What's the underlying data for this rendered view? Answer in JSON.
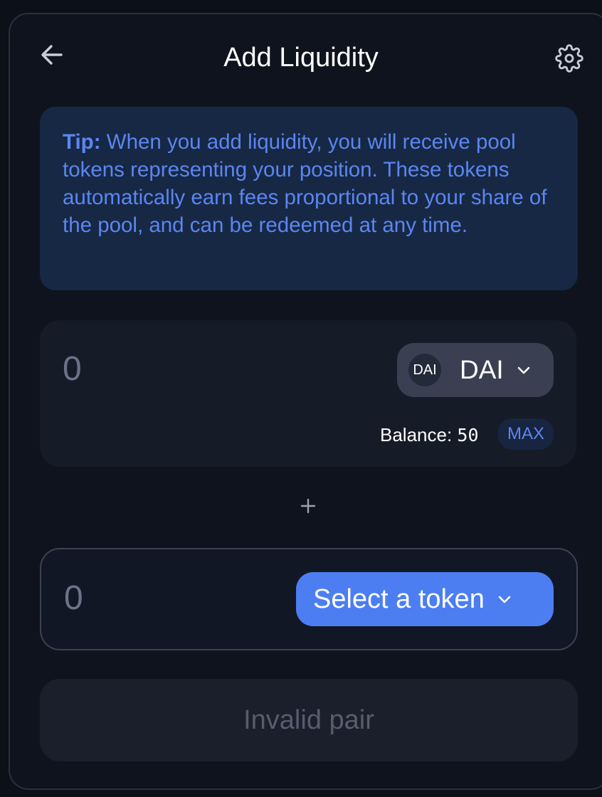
{
  "header": {
    "title": "Add Liquidity",
    "back_icon": "arrow-left-icon",
    "settings_icon": "gear-icon"
  },
  "tip": {
    "label": "Tip:",
    "text": " When you add liquidity, you will receive pool tokens representing your position. These tokens automatically earn fees proportional to your share of the pool, and can be redeemed at any time."
  },
  "input_a": {
    "placeholder": "0",
    "token_logo_text": "DAI",
    "token_symbol": "DAI",
    "balance_label": "Balance: ",
    "balance_value": "50",
    "max_label": "MAX"
  },
  "separator": {
    "icon": "plus-icon"
  },
  "input_b": {
    "placeholder": "0",
    "select_label": "Select a token"
  },
  "submit": {
    "label": "Invalid pair"
  },
  "colors": {
    "accent": "#4c7ef2",
    "tip_text": "#5b86f2",
    "tip_background": "#172844",
    "card_background": "#0f131d",
    "disabled_text": "#565d6d"
  }
}
